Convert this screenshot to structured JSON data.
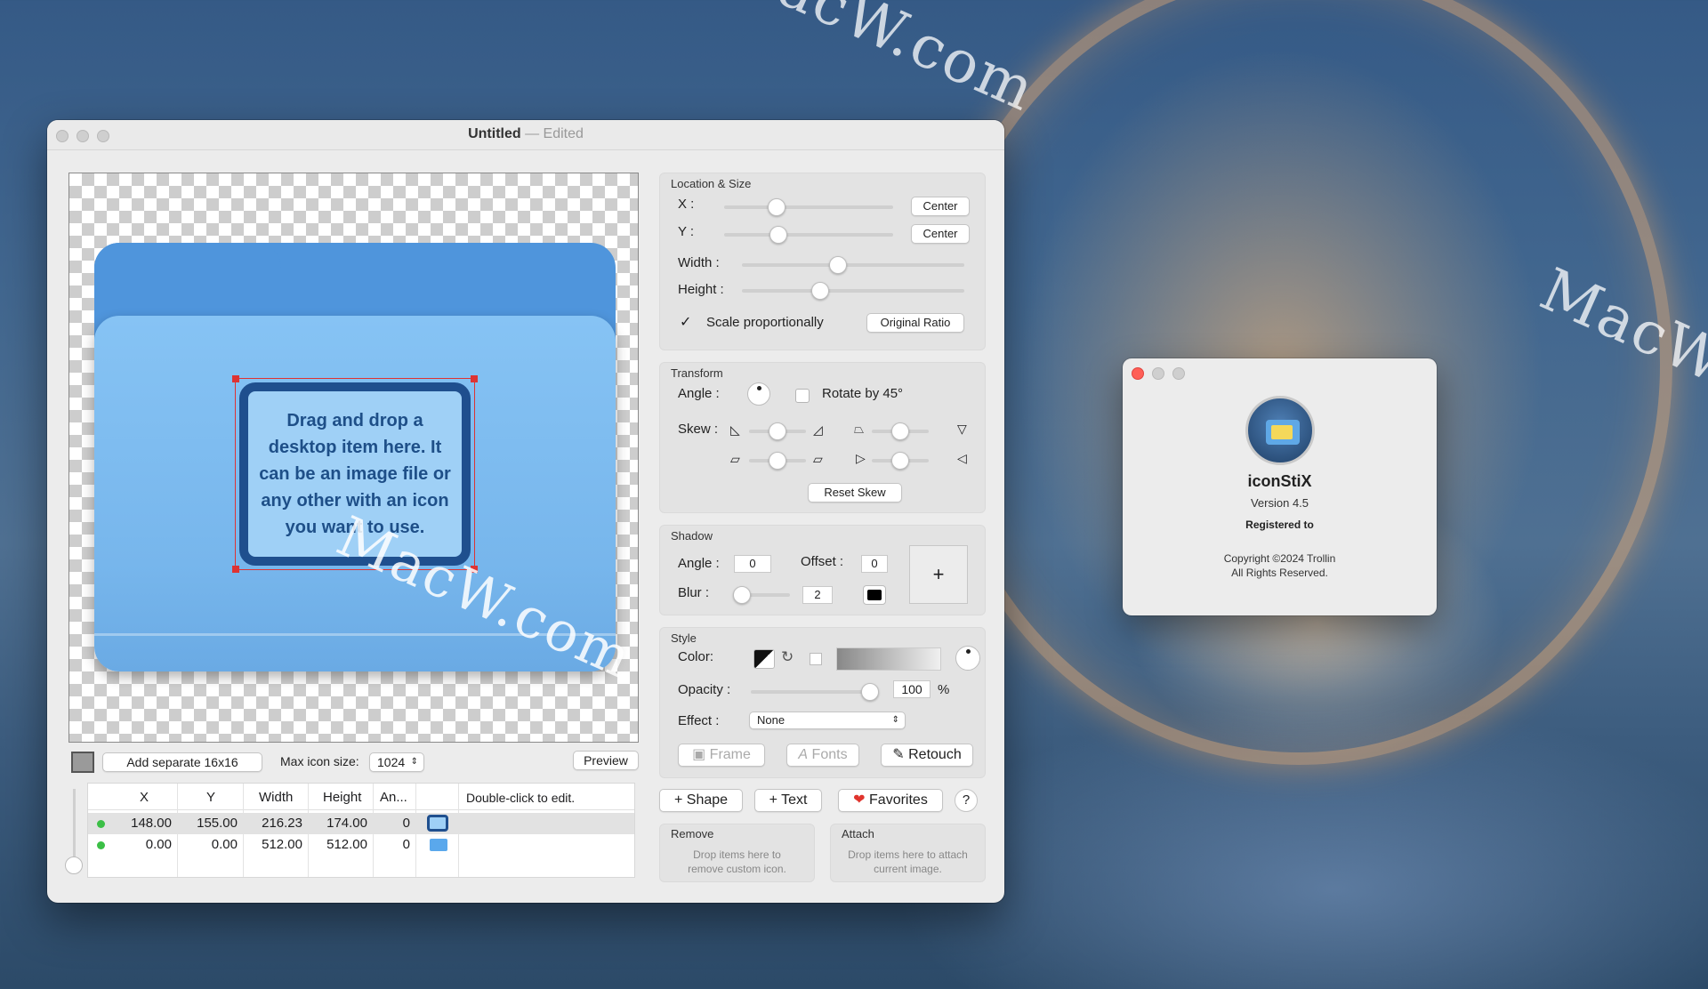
{
  "window": {
    "title": "Untitled",
    "edited": "— Edited"
  },
  "canvas": {
    "drop_hint": "Drag and drop a desktop item here. It can be an image file or any other with an icon you want to use."
  },
  "below_canvas": {
    "add_separate_label": "Add separate 16x16",
    "max_icon_label": "Max icon size:",
    "max_icon_value": "1024",
    "preview_label": "Preview"
  },
  "table": {
    "headers": [
      "X",
      "Y",
      "Width",
      "Height",
      "An...",
      "",
      "Double-click to edit."
    ],
    "rows": [
      {
        "x": "148.00",
        "y": "155.00",
        "width": "216.23",
        "height": "174.00",
        "angle": "0",
        "icon": "note-thumbnail-icon"
      },
      {
        "x": "0.00",
        "y": "0.00",
        "width": "512.00",
        "height": "512.00",
        "angle": "0",
        "icon": "folder-thumbnail-icon"
      }
    ]
  },
  "location_size": {
    "title": "Location & Size",
    "x_label": "X :",
    "y_label": "Y :",
    "center_label": "Center",
    "width_label": "Width :",
    "height_label": "Height :",
    "scale_label": "Scale proportionally",
    "original_ratio_label": "Original Ratio",
    "x_level": 0.31,
    "y_level": 0.32,
    "width_level": 0.43,
    "height_level": 0.35
  },
  "transform": {
    "title": "Transform",
    "angle_label": "Angle :",
    "rotate_label": "Rotate by 45°",
    "skew_label": "Skew :",
    "reset_skew_label": "Reset Skew"
  },
  "shadow": {
    "title": "Shadow",
    "angle_label": "Angle :",
    "angle_value": "0",
    "offset_label": "Offset :",
    "offset_value": "0",
    "blur_label": "Blur :",
    "blur_value": "2",
    "plus": "+"
  },
  "style": {
    "title": "Style",
    "color_label": "Color:",
    "opacity_label": "Opacity :",
    "opacity_value": "100",
    "percent": "%",
    "effect_label": "Effect :",
    "effect_value": "None",
    "frame_label": "Frame",
    "fonts_label": "Fonts",
    "retouch_label": "Retouch"
  },
  "bottom_buttons": {
    "shape": "Shape",
    "text": "Text",
    "favorites": "Favorites",
    "help": "?"
  },
  "remove": {
    "title": "Remove",
    "hint": "Drop items here to remove custom icon."
  },
  "attach": {
    "title": "Attach",
    "hint": "Drop items here to attach current image."
  },
  "about": {
    "app_name": "iconStiX",
    "version": "Version 4.5",
    "registered": "Registered to",
    "copyright": "Copyright ©2024 Trollin",
    "rights": "All Rights Reserved."
  },
  "watermark": "MacW.com"
}
